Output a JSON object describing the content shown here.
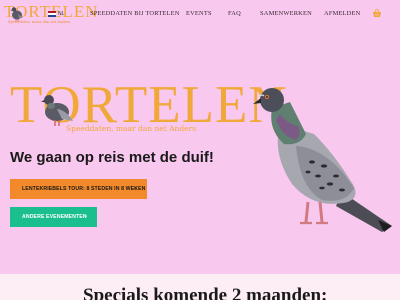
{
  "header": {
    "logo_word": "TORTELEN",
    "logo_tagline": "Speeddaten, maar dan net Anders",
    "language": {
      "code": "NL",
      "flag_colors": [
        "#ae1c28",
        "#ffffff",
        "#21468b"
      ]
    },
    "nav": [
      {
        "label": "SPEEDDATEN BIJ TORTELEN"
      },
      {
        "label": "EVENTS"
      },
      {
        "label": "FAQ"
      },
      {
        "label": "SAMENWERKEN"
      },
      {
        "label": "AFMELDEN"
      }
    ],
    "cart_icon": "shopping-basket-icon"
  },
  "hero": {
    "logo_word": "TORTELEN",
    "logo_tagline": "Speeddaten, maar dan net Anders",
    "headline": "We gaan op reis met de duif!",
    "buttons": [
      {
        "label": "LENTEKRIEBELS TOUR: 8 STEDEN IN 8 WEKEN",
        "icon": "chevron-right-icon",
        "color": "#f28a2b"
      },
      {
        "label": "ANDERE EVENEMENTEN",
        "icon": "chevron-right-icon",
        "color": "#1bbf8f"
      }
    ],
    "image": "pigeon-photo"
  },
  "specials": {
    "title": "Specials komende 2 maanden:"
  },
  "colors": {
    "background": "#f9c8ee",
    "brand_orange": "#f1a83a"
  }
}
